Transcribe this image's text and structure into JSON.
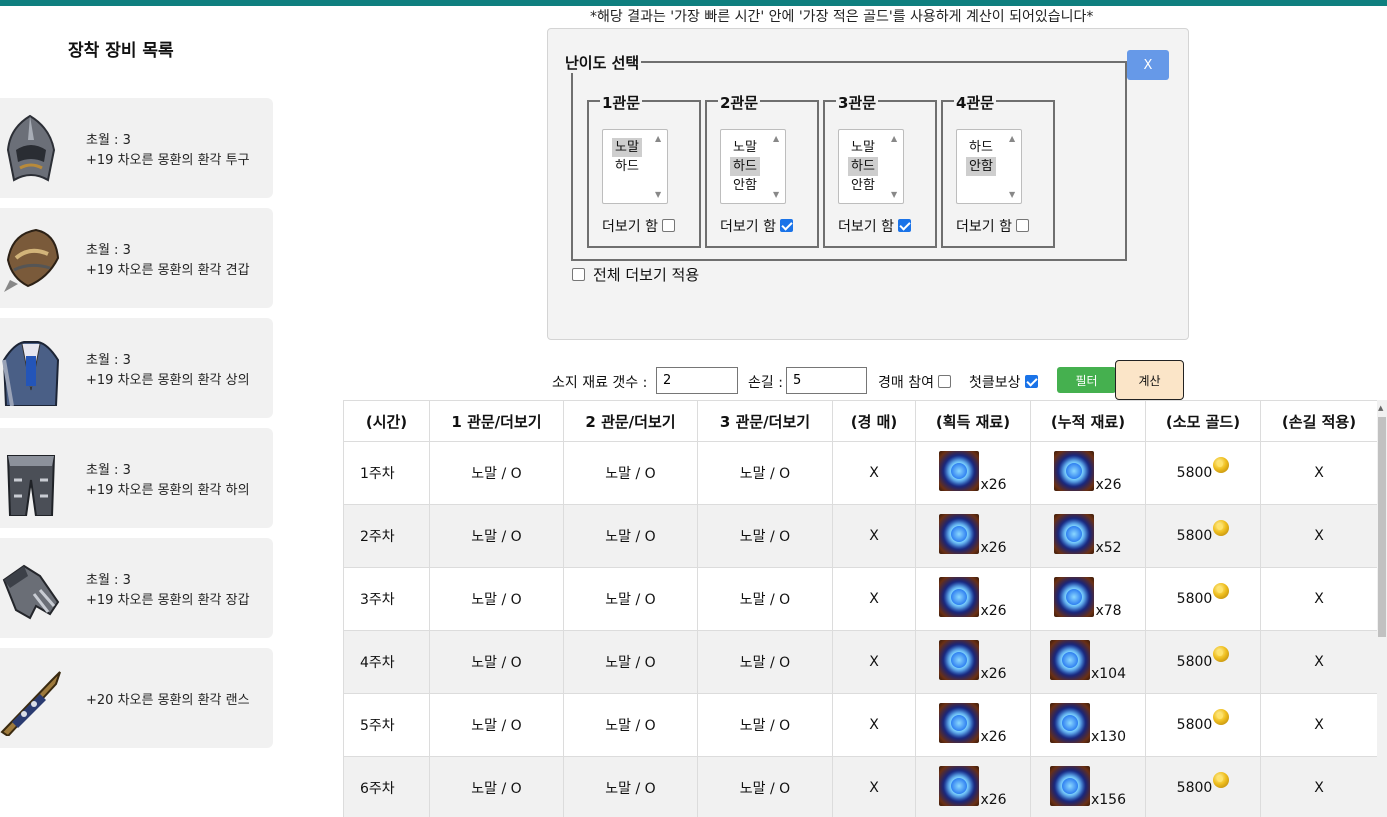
{
  "note": "*해당 결과는 '가장 빠른 시간' 안에 '가장 적은 골드'를 사용하게 계산이 되어있습니다*",
  "sidebar": {
    "title": "장착 장비 목록",
    "items": [
      {
        "line1": "초월 : 3",
        "line2": "+19 차오른 몽환의 환각 투구",
        "icon": "helmet-icon"
      },
      {
        "line1": "초월 : 3",
        "line2": "+19 차오른 몽환의 환각 견갑",
        "icon": "shoulder-icon"
      },
      {
        "line1": "초월 : 3",
        "line2": "+19 차오른 몽환의 환각 상의",
        "icon": "chest-armor-icon"
      },
      {
        "line1": "초월 : 3",
        "line2": "+19 차오른 몽환의 환각 하의",
        "icon": "leg-armor-icon"
      },
      {
        "line1": "초월 : 3",
        "line2": "+19 차오른 몽환의 환각 장갑",
        "icon": "gauntlet-icon"
      },
      {
        "line1": "",
        "line2": "+20 차오른 몽환의 환각 랜스",
        "icon": "lance-icon"
      }
    ]
  },
  "difficulty": {
    "legend": "난이도 선택",
    "close_label": "X",
    "gates": [
      {
        "legend": "1관문",
        "options": [
          "노말",
          "하드"
        ],
        "selected": 0,
        "more_label": "더보기 함",
        "more": false
      },
      {
        "legend": "2관문",
        "options": [
          "노말",
          "하드",
          "안함"
        ],
        "selected": 1,
        "more_label": "더보기 함",
        "more": true
      },
      {
        "legend": "3관문",
        "options": [
          "노말",
          "하드",
          "안함"
        ],
        "selected": 1,
        "more_label": "더보기 함",
        "more": true
      },
      {
        "legend": "4관문",
        "options": [
          "하드",
          "안함"
        ],
        "selected": 1,
        "more_label": "더보기 함",
        "more": false
      }
    ],
    "apply_all_label": "전체 더보기 적용",
    "apply_all": false
  },
  "filter": {
    "material_label": "소지 재료 갯수 :",
    "material_value": "2",
    "hands_label": "손길 :",
    "hands_value": "5",
    "auction_label": "경매 참여",
    "auction": false,
    "first_clear_label": "첫클보상",
    "first_clear": true,
    "filter_button": "필터",
    "calc_button": "계산"
  },
  "table": {
    "headers": [
      "(시간)",
      "1 관문/더보기",
      "2 관문/더보기",
      "3 관문/더보기",
      "(경 매)",
      "(획득 재료)",
      "(누적 재료)",
      "(소모 골드)",
      "(손길 적용)"
    ],
    "rows": [
      {
        "time": "1주차",
        "g1": "노말 / O",
        "g2": "노말 / O",
        "g3": "노말 / O",
        "auction": "X",
        "gain": "x26",
        "total": "x26",
        "gold": "5800",
        "hands": "X"
      },
      {
        "time": "2주차",
        "g1": "노말 / O",
        "g2": "노말 / O",
        "g3": "노말 / O",
        "auction": "X",
        "gain": "x26",
        "total": "x52",
        "gold": "5800",
        "hands": "X"
      },
      {
        "time": "3주차",
        "g1": "노말 / O",
        "g2": "노말 / O",
        "g3": "노말 / O",
        "auction": "X",
        "gain": "x26",
        "total": "x78",
        "gold": "5800",
        "hands": "X"
      },
      {
        "time": "4주차",
        "g1": "노말 / O",
        "g2": "노말 / O",
        "g3": "노말 / O",
        "auction": "X",
        "gain": "x26",
        "total": "x104",
        "gold": "5800",
        "hands": "X"
      },
      {
        "time": "5주차",
        "g1": "노말 / O",
        "g2": "노말 / O",
        "g3": "노말 / O",
        "auction": "X",
        "gain": "x26",
        "total": "x130",
        "gold": "5800",
        "hands": "X"
      },
      {
        "time": "6주차",
        "g1": "노말 / O",
        "g2": "노말 / O",
        "g3": "노말 / O",
        "auction": "X",
        "gain": "x26",
        "total": "x156",
        "gold": "5800",
        "hands": "X"
      }
    ]
  },
  "colors": {
    "topbar": "#0f7f7f",
    "close_button": "#6699e8",
    "filter_button": "#45b04f",
    "calc_button": "#fbe5c8"
  }
}
